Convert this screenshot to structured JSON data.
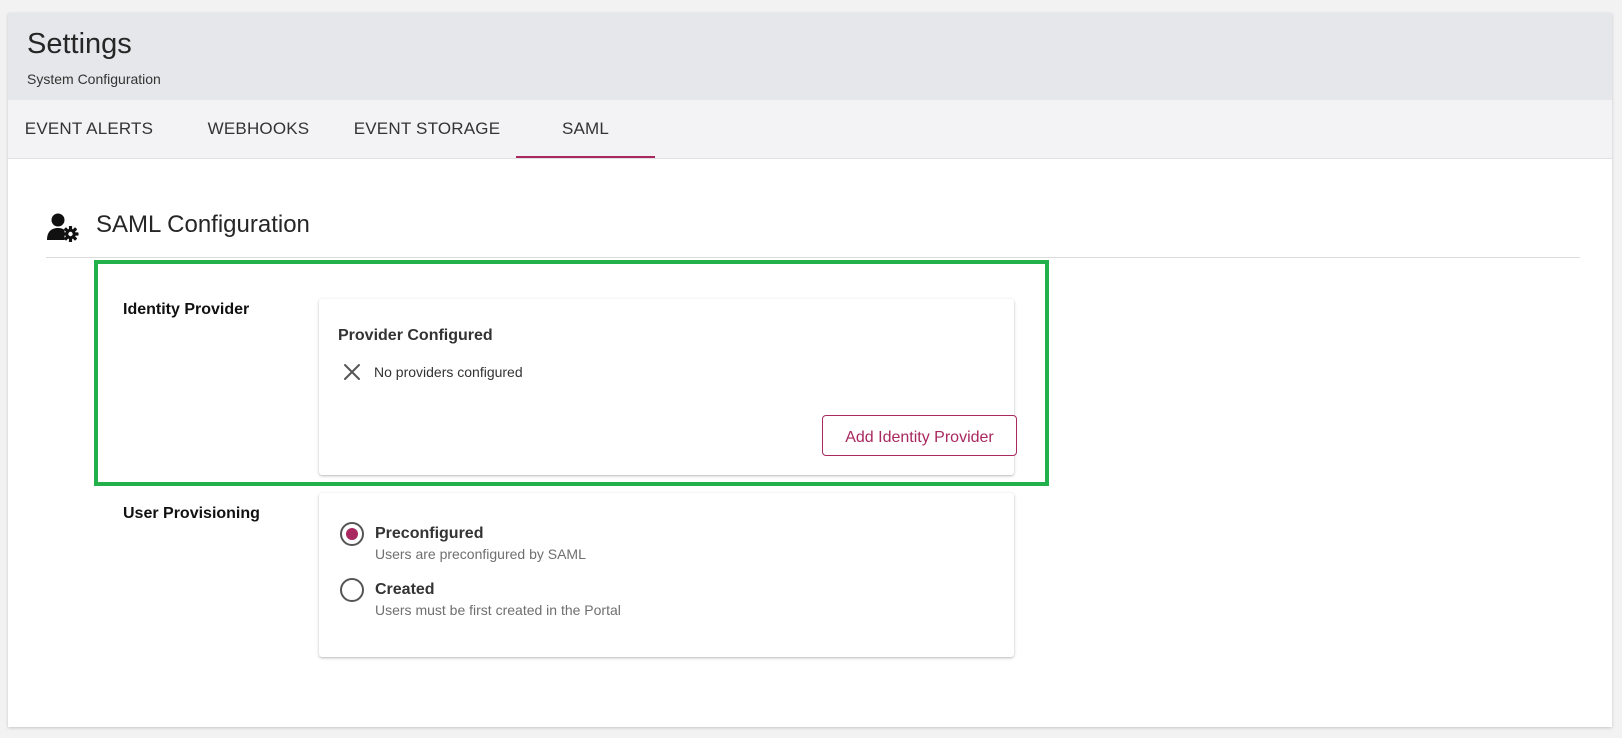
{
  "header": {
    "title": "Settings",
    "subtitle": "System Configuration"
  },
  "tabs": [
    {
      "label": "EVENT ALERTS",
      "active": false
    },
    {
      "label": "WEBHOOKS",
      "active": false
    },
    {
      "label": "EVENT STORAGE",
      "active": false
    },
    {
      "label": "SAML",
      "active": true
    }
  ],
  "section": {
    "icon": "user-gear-icon",
    "title": "SAML Configuration"
  },
  "identity_provider": {
    "label": "Identity Provider",
    "card_title": "Provider Configured",
    "status_icon": "close-icon",
    "status_text": "No providers configured",
    "add_button_label": "Add Identity Provider"
  },
  "user_provisioning": {
    "label": "User Provisioning",
    "options": [
      {
        "label": "Preconfigured",
        "description": "Users are preconfigured by SAML",
        "selected": true
      },
      {
        "label": "Created",
        "description": "Users must be first created in the Portal",
        "selected": false
      }
    ]
  },
  "colors": {
    "accent": "#a8285f",
    "highlight": "#22b04b",
    "header_bg": "#e6e7ea"
  }
}
